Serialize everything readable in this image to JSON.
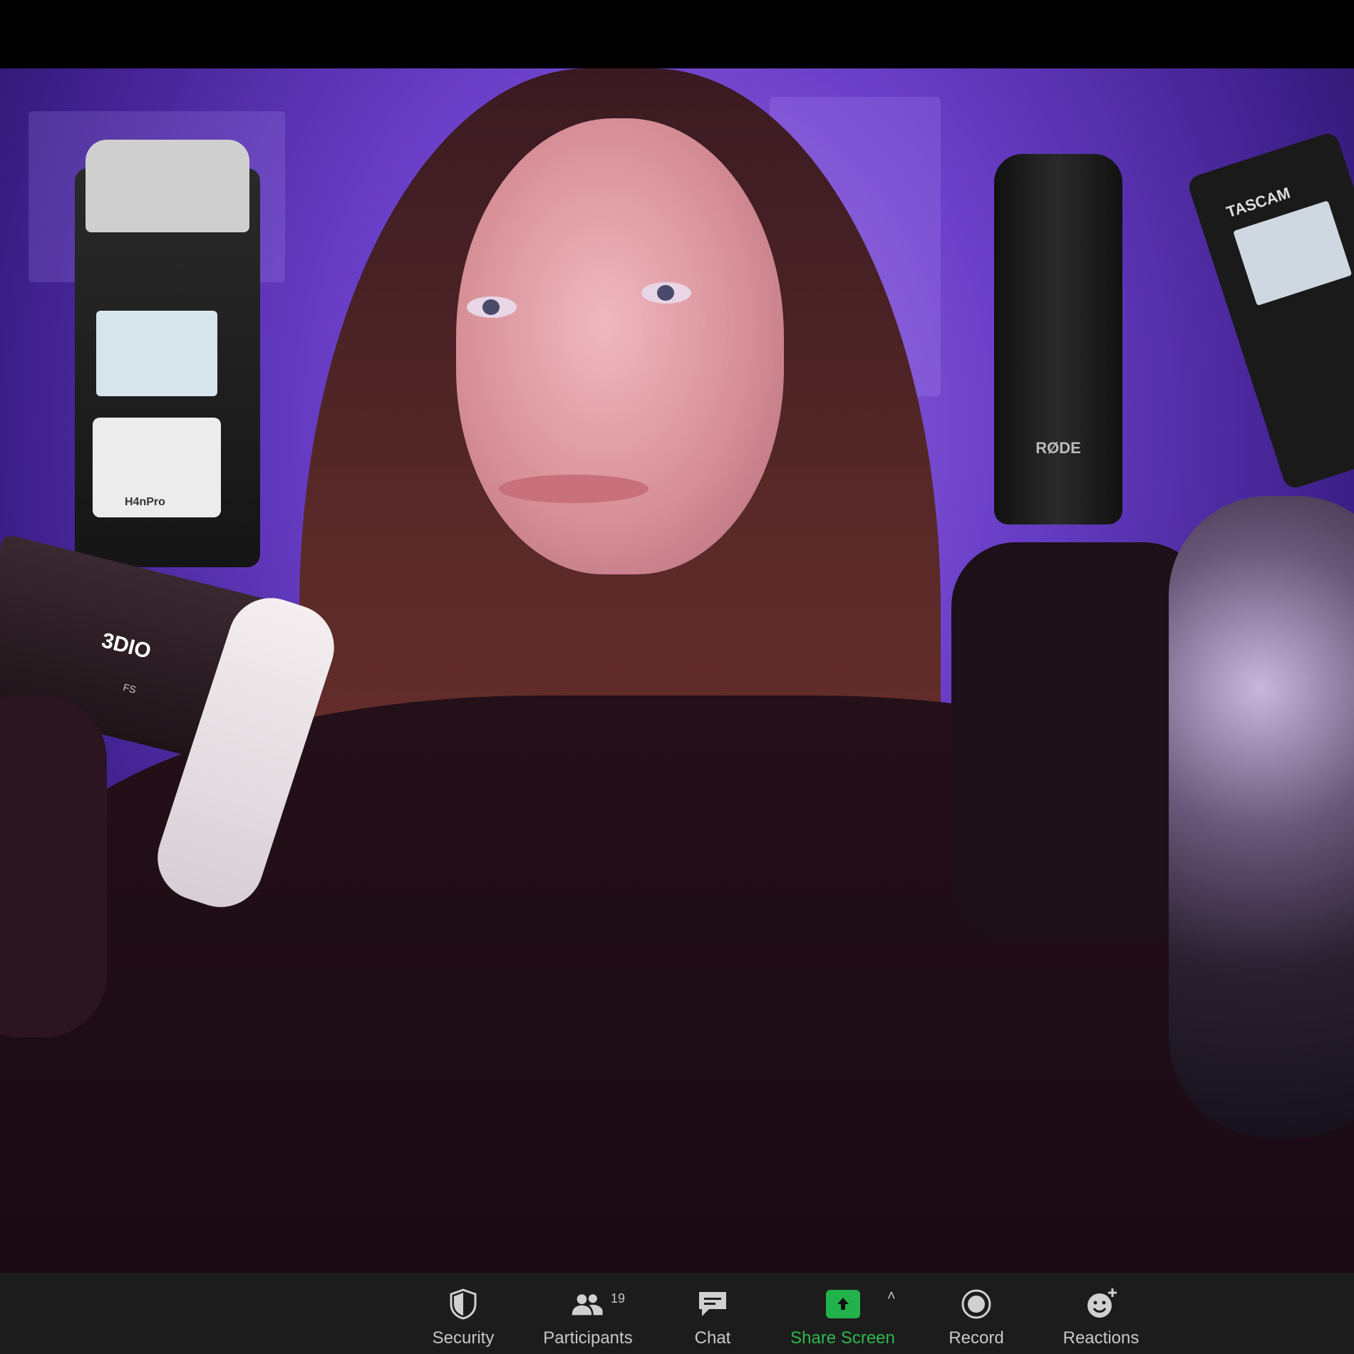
{
  "video": {
    "props": {
      "zoom_recorder_label": "H4nPro",
      "rode_label": "RØDE",
      "tascam_label": "TASCAM",
      "dio_label": "3DIO",
      "dio_sub": "FS"
    }
  },
  "toolbar": {
    "items": [
      {
        "label": "Security",
        "icon": "shield-icon"
      },
      {
        "label": "Participants",
        "icon": "participants-icon",
        "count": "19"
      },
      {
        "label": "Chat",
        "icon": "chat-icon"
      },
      {
        "label": "Share Screen",
        "icon": "share-screen-icon",
        "color": "#2fb84e"
      },
      {
        "label": "Record",
        "icon": "record-icon"
      },
      {
        "label": "Reactions",
        "icon": "reactions-icon"
      }
    ]
  }
}
